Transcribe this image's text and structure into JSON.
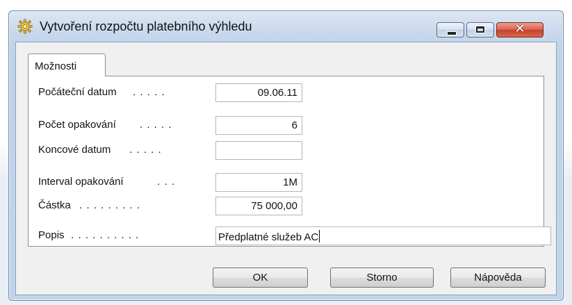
{
  "window": {
    "title": "Vytvoření rozpočtu platebního výhledu",
    "icon": "gear-icon",
    "controls": {
      "minimize": "minimize-icon",
      "maximize": "maximize-icon",
      "close_label": "✕"
    }
  },
  "tabs": [
    {
      "label": "Možnosti",
      "selected": true
    }
  ],
  "form": {
    "start_date": {
      "label": "Počáteční datum",
      "dots": " . . . . .",
      "value": "09.06.11"
    },
    "repeat_count": {
      "label": "Počet opakování",
      "dots": ". . . . .",
      "value": "6"
    },
    "end_date": {
      "label": "Koncové datum",
      "dots": " . . . . .",
      "value": ""
    },
    "repeat_interval": {
      "label": "Interval opakování",
      "dots": " . . .",
      "value": "1M"
    },
    "amount": {
      "label": "Částka",
      "dots": " . . . . . . . . .",
      "value": "75 000,00"
    },
    "description": {
      "label": "Popis",
      "dots": " . . . . . . . . . .",
      "value": "Předplatné služeb AC"
    }
  },
  "buttons": {
    "ok": "OK",
    "cancel": "Storno",
    "help": "Nápověda"
  }
}
